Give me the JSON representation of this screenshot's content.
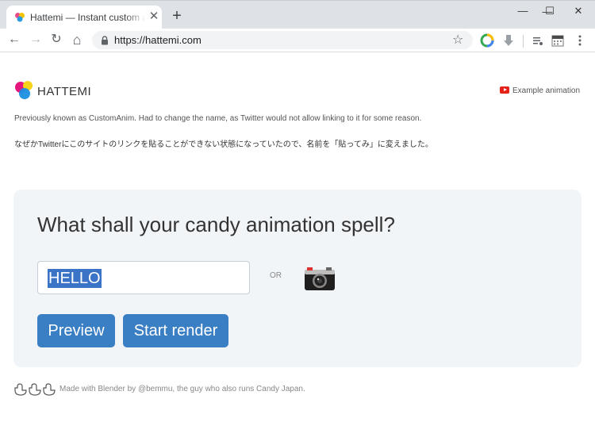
{
  "browser": {
    "tab_title": "Hattemi — Instant custom animation",
    "tab_close": "✕",
    "new_tab": "+",
    "url": "https://hattemi.com",
    "window_controls": {
      "minimize": "—",
      "maximize": "☐",
      "close": "✕"
    },
    "nav": {
      "back": "←",
      "forward": "→",
      "reload": "↻",
      "home": "⌂"
    },
    "star": "☆"
  },
  "header": {
    "brand_name": "HATTEMI",
    "example_link": "Example animation"
  },
  "notes": {
    "english": "Previously known as CustomAnim. Had to change the name, as Twitter would not allow linking to it for some reason.",
    "japanese": "なぜかTwitterにこのサイトのリンクを貼ることができない状態になっていたので、名前を「貼ってみ」に変えました。"
  },
  "form": {
    "title": "What shall your candy animation spell?",
    "input_value": "HELLO",
    "or_label": "OR",
    "preview_button": "Preview",
    "render_button": "Start render"
  },
  "footer": {
    "text": "Made with Blender by @bemmu, the guy who also runs Candy Japan."
  },
  "colors": {
    "button": "#3a7ec4",
    "card_background": "#f2f5f8",
    "selection": "#3b73c6",
    "youtube_red": "#e62117"
  }
}
